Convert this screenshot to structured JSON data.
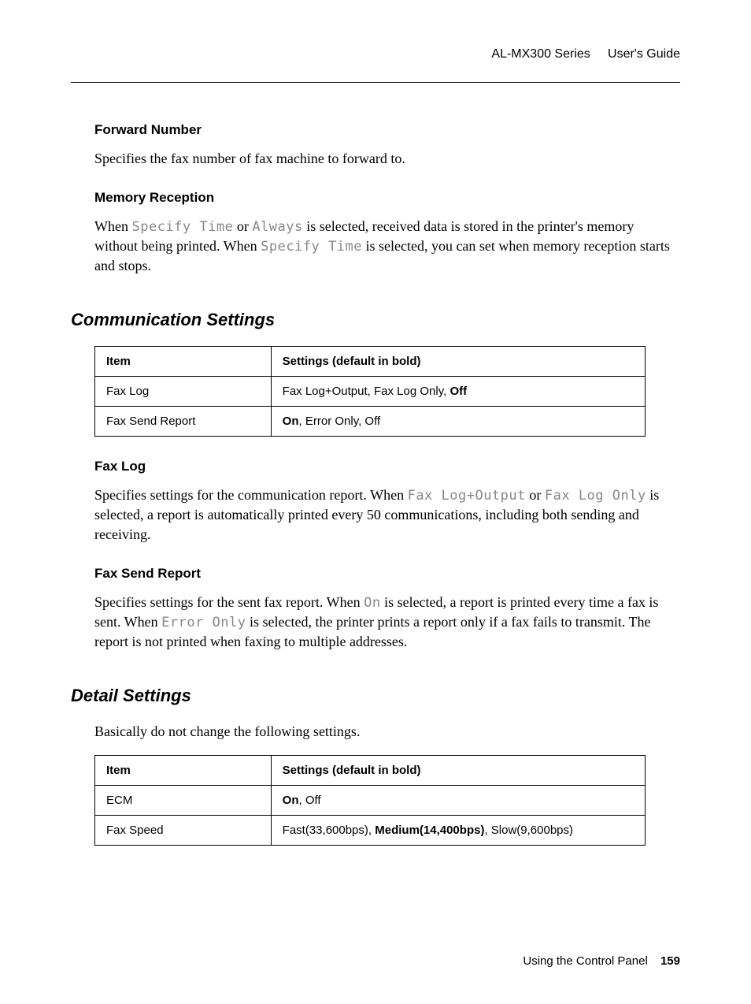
{
  "header": {
    "product": "AL-MX300 Series",
    "doc": "User's Guide"
  },
  "sections": {
    "forward_number": {
      "title": "Forward Number",
      "body": "Specifies the fax number of fax machine to forward to."
    },
    "memory_reception": {
      "title": "Memory Reception",
      "body_parts": {
        "p1": "When ",
        "lcd1": "Specify Time",
        "p2": " or ",
        "lcd2": "Always",
        "p3": " is selected, received data is stored in the printer's memory without being printed. When ",
        "lcd3": "Specify Time",
        "p4": " is selected, you can set when memory reception starts and stops."
      }
    },
    "communication_settings": {
      "title": "Communication Settings",
      "table": {
        "head_item": "Item",
        "head_settings": "Settings (default in bold)",
        "rows": [
          {
            "item": "Fax Log",
            "pre": "Fax Log+Output, Fax Log Only, ",
            "bold": "Off",
            "post": ""
          },
          {
            "item": "Fax Send Report",
            "pre": "",
            "bold": "On",
            "post": ", Error Only, Off"
          }
        ]
      },
      "fax_log": {
        "title": "Fax Log",
        "body_parts": {
          "p1": "Specifies settings for the communication report. When ",
          "lcd1": "Fax Log+Output",
          "p2": " or ",
          "lcd2": "Fax Log Only",
          "p3": " is selected, a report is automatically printed every 50 communications, including both sending and receiving."
        }
      },
      "fax_send_report": {
        "title": "Fax Send Report",
        "body_parts": {
          "p1": "Specifies settings for the sent fax report. When ",
          "lcd1": "On",
          "p2": " is selected, a report is printed every time a fax is sent. When ",
          "lcd2": "Error Only",
          "p3": " is selected, the printer prints a report only if a fax fails to transmit. The report is not printed when faxing to multiple addresses."
        }
      }
    },
    "detail_settings": {
      "title": "Detail Settings",
      "intro": "Basically do not change the following settings.",
      "table": {
        "head_item": "Item",
        "head_settings": "Settings (default in bold)",
        "rows": [
          {
            "item": "ECM",
            "pre": "",
            "bold": "On",
            "post": ", Off"
          },
          {
            "item": "Fax Speed",
            "pre": "Fast(33,600bps), ",
            "bold": "Medium(14,400bps)",
            "post": ", Slow(9,600bps)"
          }
        ]
      }
    }
  },
  "footer": {
    "chapter": "Using the Control Panel",
    "page": "159"
  }
}
